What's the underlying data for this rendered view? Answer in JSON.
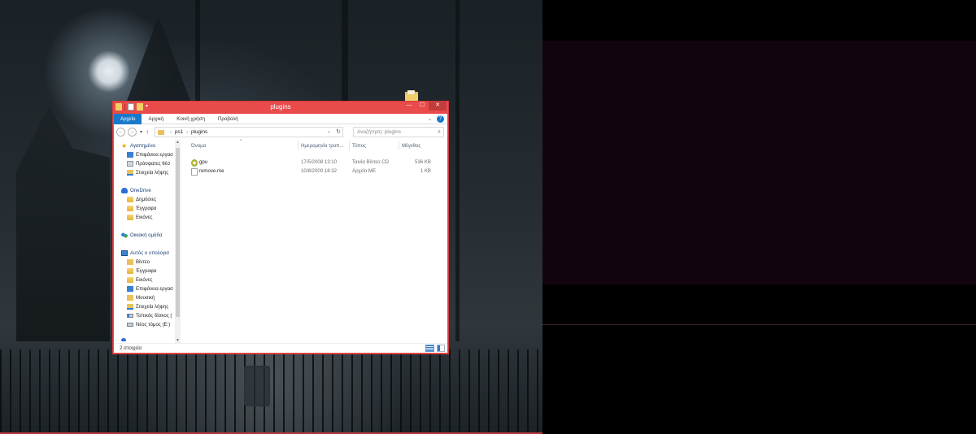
{
  "window": {
    "title": "plugins"
  },
  "ribbon": {
    "tabs": [
      "Αρχείο",
      "Αρχική",
      "Κοινή χρήση",
      "Προβολή"
    ],
    "active_tab": 0
  },
  "address": {
    "path": [
      "ps1",
      "plugins"
    ],
    "search_placeholder": "Αναζήτηση: plugins"
  },
  "nav": {
    "favorites": {
      "label": "Αγαπημένα",
      "items": [
        "Επιφάνεια εργασ",
        "Πρόσφατες θέσ",
        "Στοιχεία λήψης"
      ]
    },
    "onedrive": {
      "label": "OneDrive",
      "items": [
        "Δημόσιες",
        "Έγγραφα",
        "Εικόνες"
      ]
    },
    "homegroup": {
      "label": "Οικιακή ομάδα"
    },
    "thispc": {
      "label": "Αυτός ο υπολογισ",
      "items": [
        "Βίντεο",
        "Έγγραφα",
        "Εικόνες",
        "Επιφάνεια εργασ",
        "Μουσική",
        "Στοιχεία λήψης",
        "Τοπικός δίσκος (",
        "Νέος τόμος (E:)"
      ]
    }
  },
  "files": {
    "columns": [
      "Όνομα",
      "Ημερομηνία τροπ...",
      "Τύπος",
      "Μέγεθος"
    ],
    "rows": [
      {
        "name": "gpu",
        "date": "17/5/2008 13:10",
        "type": "Ταινία Βίντεο CD",
        "size": "536 KB",
        "icon": "cd-video-icon"
      },
      {
        "name": "remove.me",
        "date": "10/8/2000 18:32",
        "type": "Αρχείο ME",
        "size": "1 KB",
        "icon": "text-file-icon"
      }
    ]
  },
  "status": {
    "text": "2 στοιχεία"
  },
  "colors": {
    "window_border": "#e94b4b",
    "ribbon_active": "#1979ca",
    "desktop_right": "#12040f"
  }
}
